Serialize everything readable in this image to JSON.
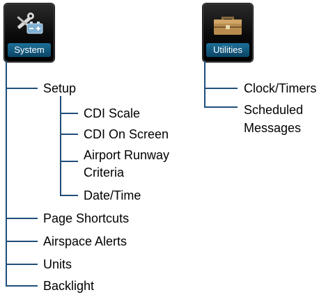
{
  "buttons": {
    "system": {
      "label": "System",
      "icon": "tools-battery-icon"
    },
    "utilities": {
      "label": "Utilities",
      "icon": "toolbox-icon"
    }
  },
  "system_tree": {
    "setup": {
      "label": "Setup",
      "children": [
        "CDI Scale",
        "CDI On Screen",
        "Airport Runway",
        "Criteria",
        "Date/Time"
      ]
    },
    "items": [
      "Page Shortcuts",
      "Airspace Alerts",
      "Units",
      "Backlight"
    ]
  },
  "utilities_tree": {
    "items": [
      "Clock/Timers",
      "Scheduled",
      "Messages"
    ]
  },
  "colors": {
    "line": "#1f4e79",
    "caption": "#1d6f98"
  }
}
